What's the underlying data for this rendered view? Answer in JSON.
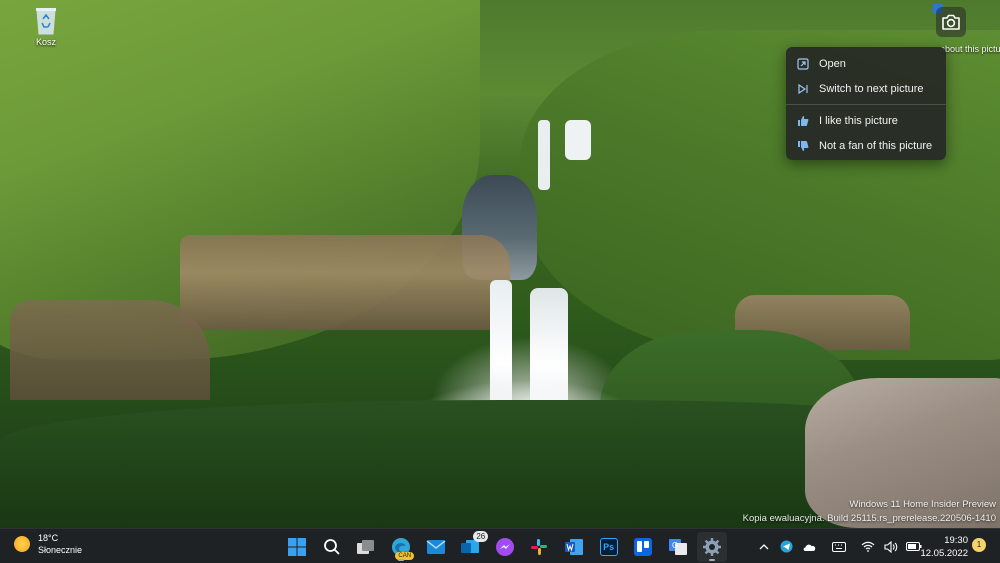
{
  "desktop": {
    "recycle_bin_label": "Kosz"
  },
  "spotlight": {
    "about_label": "about this picture",
    "menu": {
      "open": "Open",
      "next": "Switch to next picture",
      "like": "I like this picture",
      "dislike": "Not a fan of this picture"
    }
  },
  "watermark": {
    "line1": "Windows 11 Home Insider Preview",
    "line2": "Kopia ewaluacyjna. Build 25115.rs_prerelease.220506-1410"
  },
  "taskbar": {
    "weather": {
      "temp": "18°C",
      "condition": "Słonecznie"
    },
    "apps": [
      {
        "name": "start",
        "icon": "windows-icon"
      },
      {
        "name": "search",
        "icon": "search-icon"
      },
      {
        "name": "task-view",
        "icon": "task-view-icon"
      },
      {
        "name": "edge-canary",
        "icon": "edge-icon",
        "badge": "CAN"
      },
      {
        "name": "mail",
        "icon": "mail-icon"
      },
      {
        "name": "outlook",
        "icon": "outlook-icon",
        "badge": "26"
      },
      {
        "name": "messenger",
        "icon": "messenger-icon"
      },
      {
        "name": "slack",
        "icon": "slack-icon"
      },
      {
        "name": "word",
        "icon": "word-icon"
      },
      {
        "name": "photoshop",
        "icon": "photoshop-icon",
        "text": "Ps"
      },
      {
        "name": "trello",
        "icon": "trello-icon"
      },
      {
        "name": "google-translate",
        "icon": "translate-icon"
      },
      {
        "name": "settings",
        "icon": "gear-icon"
      }
    ],
    "clock": {
      "time": "19:30",
      "date": "12.05.2022"
    },
    "notifications": "1"
  },
  "colors": {
    "taskbar_bg": "#1f2225",
    "menu_bg": "#262826",
    "accent": "#2b78d3"
  }
}
